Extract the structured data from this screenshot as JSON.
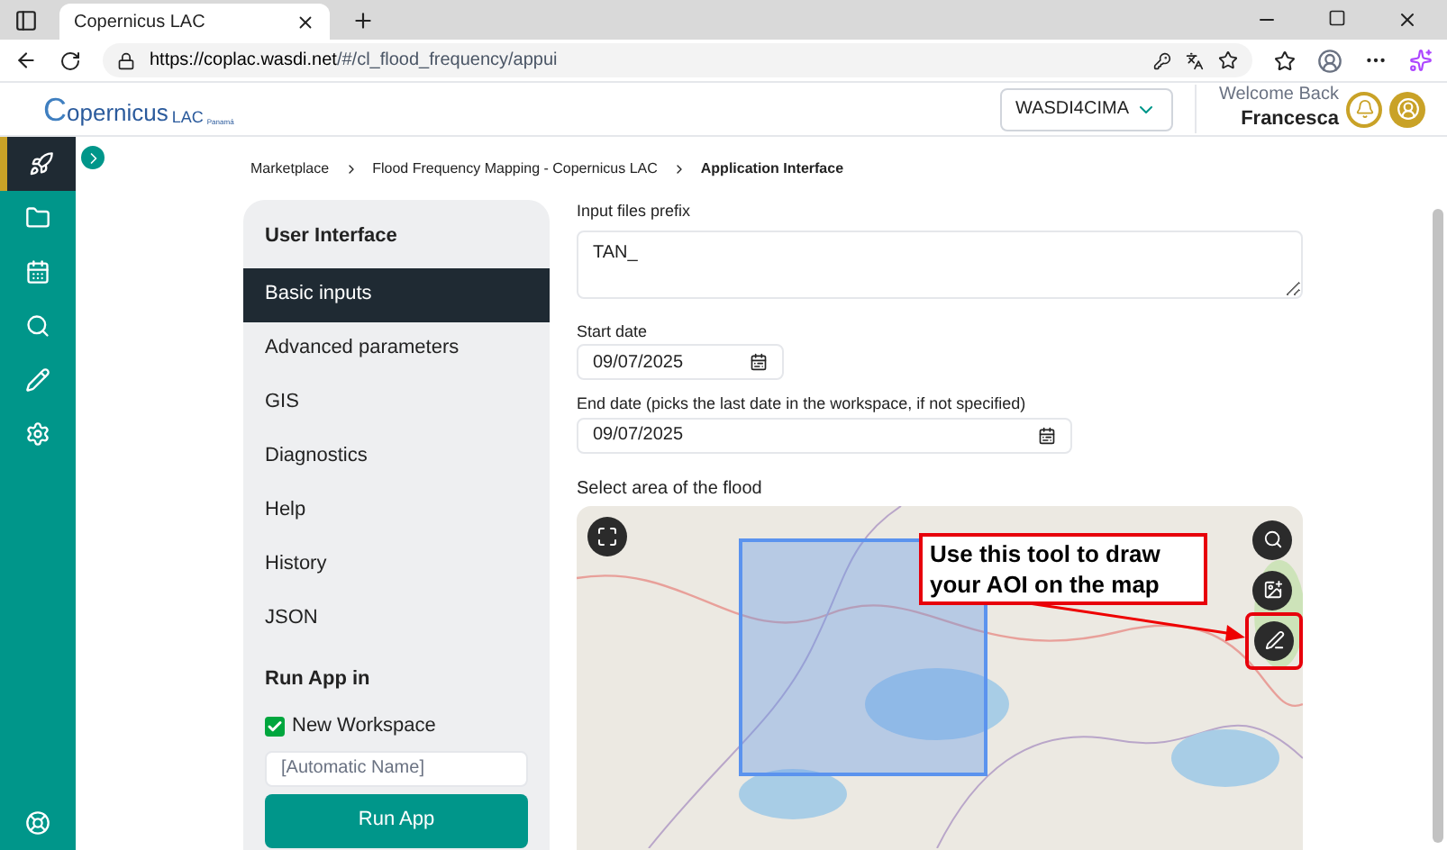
{
  "browser": {
    "tab_title": "Copernicus LAC",
    "url_host": "https://coplac.wasdi.net",
    "url_path": "/#/cl_flood_frequency/appui"
  },
  "header": {
    "logo_text": "Copernicus",
    "logo_suffix": "LAC",
    "logo_sub": "Panamá",
    "workspace": "WASDI4CIMA",
    "welcome": "Welcome Back",
    "user": "Francesca"
  },
  "sidebar": {
    "items": [
      {
        "selected": true
      },
      {
        "selected": false
      },
      {
        "selected": false
      },
      {
        "selected": false
      },
      {
        "selected": false
      },
      {
        "selected": false
      }
    ]
  },
  "breadcrumb": [
    {
      "label": "Marketplace",
      "current": false
    },
    {
      "label": "Flood Frequency Mapping - Copernicus LAC",
      "current": false
    },
    {
      "label": "Application Interface",
      "current": true
    }
  ],
  "panel": {
    "title": "User Interface",
    "tabs": [
      {
        "label": "Basic inputs",
        "selected": true
      },
      {
        "label": "Advanced parameters",
        "selected": false
      },
      {
        "label": "GIS",
        "selected": false
      },
      {
        "label": "Diagnostics",
        "selected": false
      },
      {
        "label": "Help",
        "selected": false
      },
      {
        "label": "History",
        "selected": false
      },
      {
        "label": "JSON",
        "selected": false
      }
    ],
    "run_title": "Run App in",
    "new_workspace": {
      "label": "New Workspace",
      "checked": true
    },
    "name_placeholder": "[Automatic Name]",
    "run_button": "Run App"
  },
  "form": {
    "prefix_label": "Input files prefix",
    "prefix_value": "TAN_",
    "start_label": "Start date",
    "start_value": "09/07/2025",
    "end_label": "End date (picks the last date in the workspace, if not specified)",
    "end_value": "09/07/2025",
    "map_label": "Select area of the flood"
  },
  "callout": "Use this tool to draw your AOI on the map"
}
